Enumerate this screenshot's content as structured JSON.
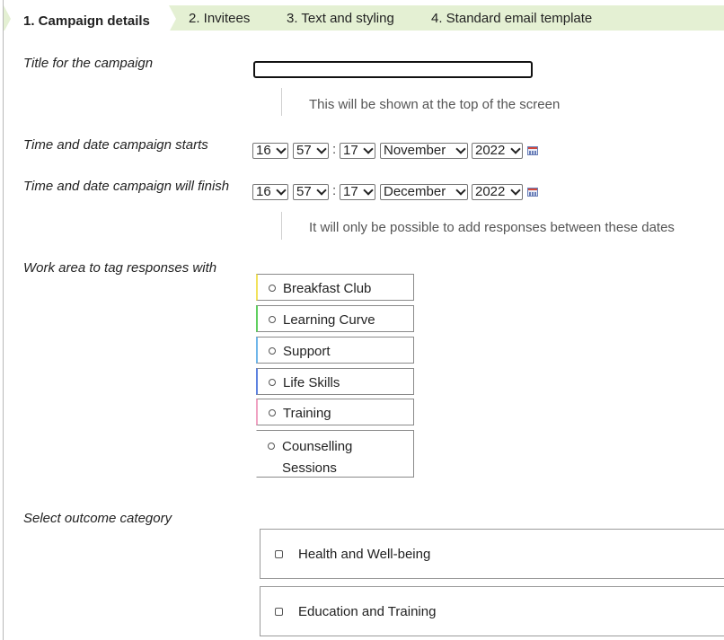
{
  "tabs": [
    {
      "label": "1. Campaign details",
      "active": true
    },
    {
      "label": "2. Invitees"
    },
    {
      "label": "3. Text and styling"
    },
    {
      "label": "4. Standard email template"
    }
  ],
  "title_field": {
    "label": "Title for the campaign",
    "value": "",
    "hint": "This will be shown at the top of the screen"
  },
  "start": {
    "label": "Time and date campaign starts",
    "hour": "16",
    "minute": "57",
    "second": "17",
    "month": "November",
    "year": "2022"
  },
  "finish": {
    "label": "Time and date campaign will finish",
    "hour": "16",
    "minute": "57",
    "second": "17",
    "month": "December",
    "year": "2022",
    "hint": "It will only be possible to add responses between these dates"
  },
  "separator": ":",
  "work_area": {
    "label": "Work area to tag responses with",
    "items": [
      {
        "label": "Breakfast Club",
        "color": "#f2e25c"
      },
      {
        "label": "Learning Curve",
        "color": "#5fcf5f"
      },
      {
        "label": "Support",
        "color": "#6fb6ea"
      },
      {
        "label": "Life Skills",
        "color": "#5d82e0"
      },
      {
        "label": "Training",
        "color": "#f0a2c2"
      },
      {
        "label": "Counselling\nSessions",
        "color": "#ffffff"
      }
    ]
  },
  "outcome": {
    "label": "Select outcome category",
    "items": [
      {
        "label": "Health and Well-being"
      },
      {
        "label": "Education and Training"
      }
    ]
  }
}
